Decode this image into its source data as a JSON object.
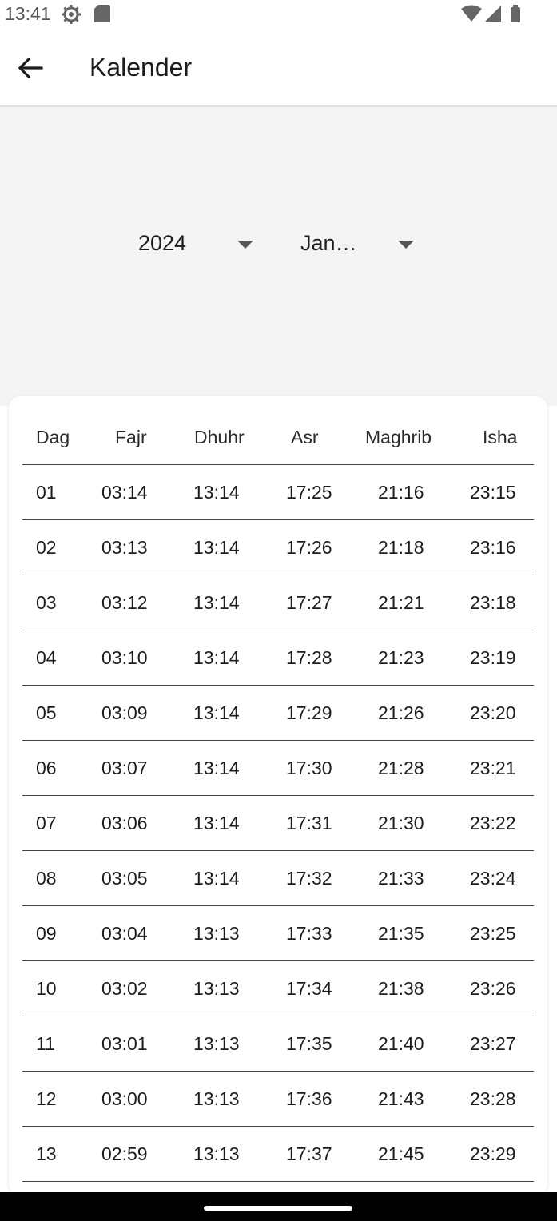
{
  "status_bar": {
    "time": "13:41"
  },
  "app_bar": {
    "title": "Kalender"
  },
  "selectors": {
    "year": "2024",
    "month": "Jan…"
  },
  "table": {
    "headers": [
      "Dag",
      "Fajr",
      "Dhuhr",
      "Asr",
      "Maghrib",
      "Isha"
    ],
    "rows": [
      [
        "01",
        "03:14",
        "13:14",
        "17:25",
        "21:16",
        "23:15"
      ],
      [
        "02",
        "03:13",
        "13:14",
        "17:26",
        "21:18",
        "23:16"
      ],
      [
        "03",
        "03:12",
        "13:14",
        "17:27",
        "21:21",
        "23:18"
      ],
      [
        "04",
        "03:10",
        "13:14",
        "17:28",
        "21:23",
        "23:19"
      ],
      [
        "05",
        "03:09",
        "13:14",
        "17:29",
        "21:26",
        "23:20"
      ],
      [
        "06",
        "03:07",
        "13:14",
        "17:30",
        "21:28",
        "23:21"
      ],
      [
        "07",
        "03:06",
        "13:14",
        "17:31",
        "21:30",
        "23:22"
      ],
      [
        "08",
        "03:05",
        "13:14",
        "17:32",
        "21:33",
        "23:24"
      ],
      [
        "09",
        "03:04",
        "13:13",
        "17:33",
        "21:35",
        "23:25"
      ],
      [
        "10",
        "03:02",
        "13:13",
        "17:34",
        "21:38",
        "23:26"
      ],
      [
        "11",
        "03:01",
        "13:13",
        "17:35",
        "21:40",
        "23:27"
      ],
      [
        "12",
        "03:00",
        "13:13",
        "17:36",
        "21:43",
        "23:28"
      ],
      [
        "13",
        "02:59",
        "13:13",
        "17:37",
        "21:45",
        "23:29"
      ]
    ]
  }
}
